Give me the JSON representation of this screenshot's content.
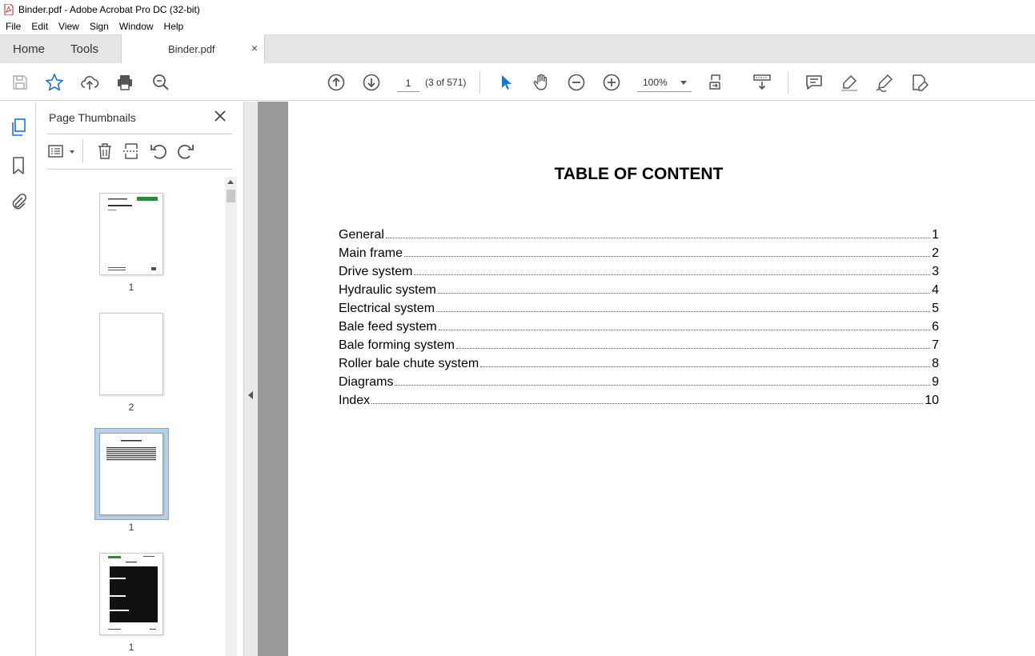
{
  "window": {
    "title": "Binder.pdf - Adobe Acrobat Pro DC (32-bit)"
  },
  "menu": [
    "File",
    "Edit",
    "View",
    "Sign",
    "Window",
    "Help"
  ],
  "tabs": {
    "home": "Home",
    "tools": "Tools",
    "document": "Binder.pdf",
    "close": "×"
  },
  "toolbar": {
    "page_input": "1",
    "page_count": "(3 of 571)",
    "zoom": "100%",
    "icons": [
      "save-icon",
      "star-icon",
      "upload-icon",
      "print-icon",
      "search-zoom-icon",
      "arrow-up-icon",
      "arrow-down-icon",
      "select-pointer-icon",
      "hand-icon",
      "zoom-out-icon",
      "zoom-in-icon",
      "page-fit-icon",
      "scroll-mode-icon",
      "comment-icon",
      "highlight-icon",
      "sign-icon",
      "edit-pdf-icon"
    ]
  },
  "rail": {
    "icons": [
      "pages-icon",
      "bookmark-icon",
      "attachment-icon"
    ]
  },
  "thumbnails": {
    "title": "Page Thumbnails",
    "pages": [
      {
        "label": "1"
      },
      {
        "label": "2"
      },
      {
        "label": "1"
      },
      {
        "label": "1"
      }
    ]
  },
  "document": {
    "toc_title": "TABLE OF CONTENT",
    "toc": [
      {
        "label": "General",
        "page": "1"
      },
      {
        "label": "Main frame",
        "page": "2"
      },
      {
        "label": "Drive system",
        "page": "3"
      },
      {
        "label": "Hydraulic system",
        "page": "4"
      },
      {
        "label": "Electrical system",
        "page": "5"
      },
      {
        "label": "Bale feed system",
        "page": "6"
      },
      {
        "label": "Bale forming system",
        "page": "7"
      },
      {
        "label": "Roller bale chute system",
        "page": "8"
      },
      {
        "label": "Diagrams",
        "page": "9"
      },
      {
        "label": "Index",
        "page": "10"
      }
    ]
  },
  "colors": {
    "accent": "#1473e6",
    "selection": "#b8d0e4",
    "fendt_green": "#2a8a3a"
  }
}
